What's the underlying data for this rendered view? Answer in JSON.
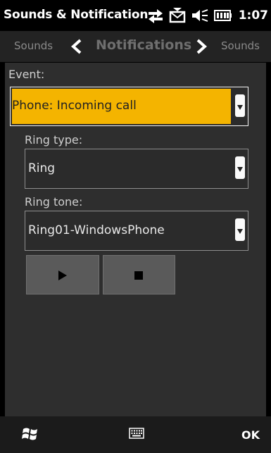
{
  "status": {
    "app_title": "Sounds & Notification",
    "time": "1:07",
    "icons": [
      "sync-icon",
      "message-icon",
      "volume-icon",
      "battery-icon"
    ]
  },
  "tabs": {
    "previous": "Sounds",
    "current": "Notifications",
    "next": "Sounds"
  },
  "form": {
    "event_label": "Event:",
    "event_value": "Phone: Incoming call",
    "ring_type_label": "Ring type:",
    "ring_type_value": "Ring",
    "ring_tone_label": "Ring tone:",
    "ring_tone_value": "Ring01-WindowsPhone",
    "play_icon": "play-icon",
    "stop_icon": "stop-icon"
  },
  "softkeys": {
    "start_icon": "windows-start-icon",
    "keyboard_icon": "keyboard-icon",
    "ok_label": "OK"
  },
  "colors": {
    "accent": "#f4b400",
    "panel": "#2e2e2e",
    "tabbar": "#232323"
  }
}
